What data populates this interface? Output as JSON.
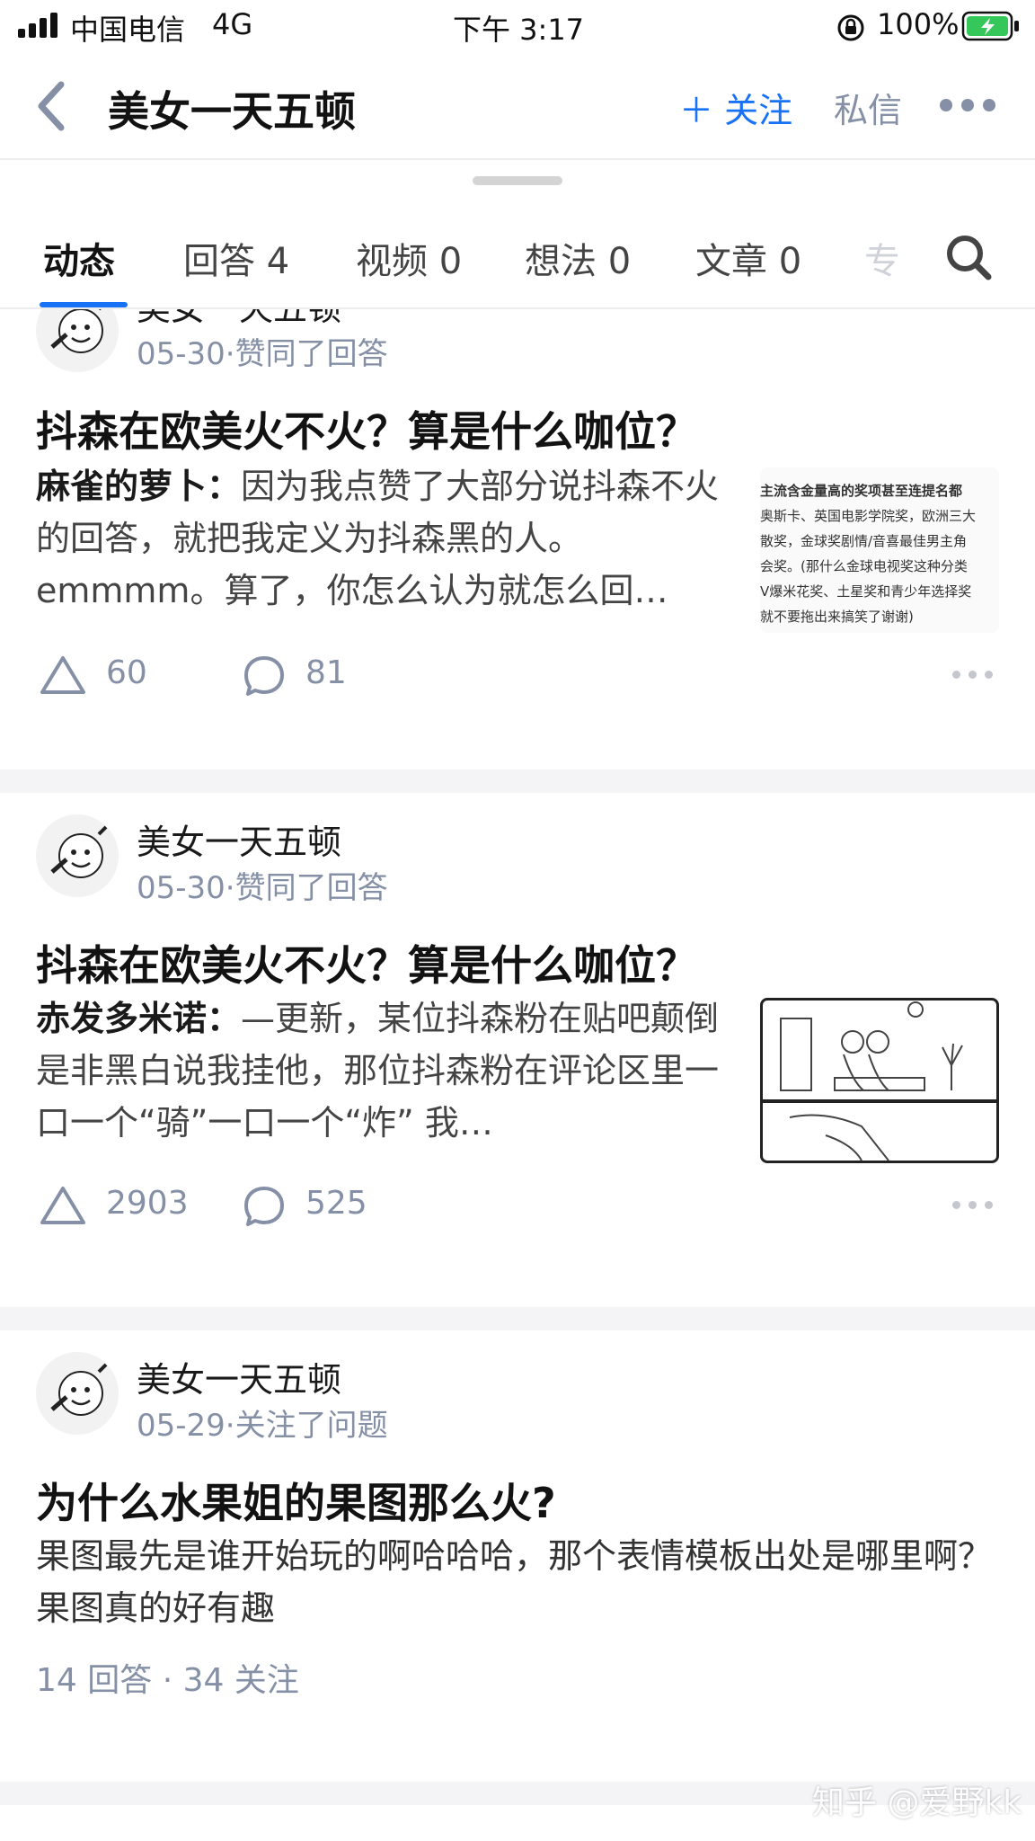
{
  "status_bar": {
    "carrier": "中国电信",
    "network": "4G",
    "time": "下午 3:17",
    "battery": "100%"
  },
  "nav": {
    "title": "美女一天五顿",
    "follow": "＋ 关注",
    "message": "私信"
  },
  "tabs": [
    {
      "label": "动态",
      "active": true
    },
    {
      "label": "回答 4"
    },
    {
      "label": "视频 0"
    },
    {
      "label": "想法 0"
    },
    {
      "label": "文章 0"
    },
    {
      "label": "专"
    }
  ],
  "feed": [
    {
      "author": "美女一天五顿",
      "meta": "05-30·赞同了回答",
      "title": "抖森在欧美火不火？算是什么咖位？",
      "excerpt_author": "麻雀的萝卜：",
      "excerpt": "因为我点赞了大部分说抖森不火的回答，就把我定义为抖森黑的人。emmmm。算了，你怎么认为就怎么回…",
      "thumb_lines": [
        "主流含金量高的奖项甚至连提名都",
        "奥斯卡、英国电影学院奖，欧洲三大",
        "散奖，金球奖剧情/音喜最佳男主角",
        "会奖。(那什么金球电视奖这种分类",
        "V爆米花奖、土星奖和青少年选择奖",
        "就不要拖出来搞笑了谢谢)"
      ],
      "votes": "60",
      "comments": "81"
    },
    {
      "author": "美女一天五顿",
      "meta": "05-30·赞同了回答",
      "title": "抖森在欧美火不火？算是什么咖位？",
      "excerpt_author": "赤发多米诺：",
      "excerpt": "—更新，某位抖森粉在贴吧颠倒是非黑白说我挂他，那位抖森粉在评论区里一口一个“骑”一口一个“炸” 我…",
      "votes": "2903",
      "comments": "525"
    },
    {
      "author": "美女一天五顿",
      "meta": "05-29·关注了问题",
      "title": "为什么水果姐的果图那么火?",
      "excerpt": "果图最先是谁开始玩的啊哈哈哈，那个表情模板出处是哪里啊？果图真的好有趣",
      "stats": "14 回答 · 34 关注"
    }
  ],
  "watermark": "知乎 @爱野kk",
  "colors": {
    "accent": "#1772f6",
    "muted": "#8590a6",
    "battery": "#35c759"
  }
}
